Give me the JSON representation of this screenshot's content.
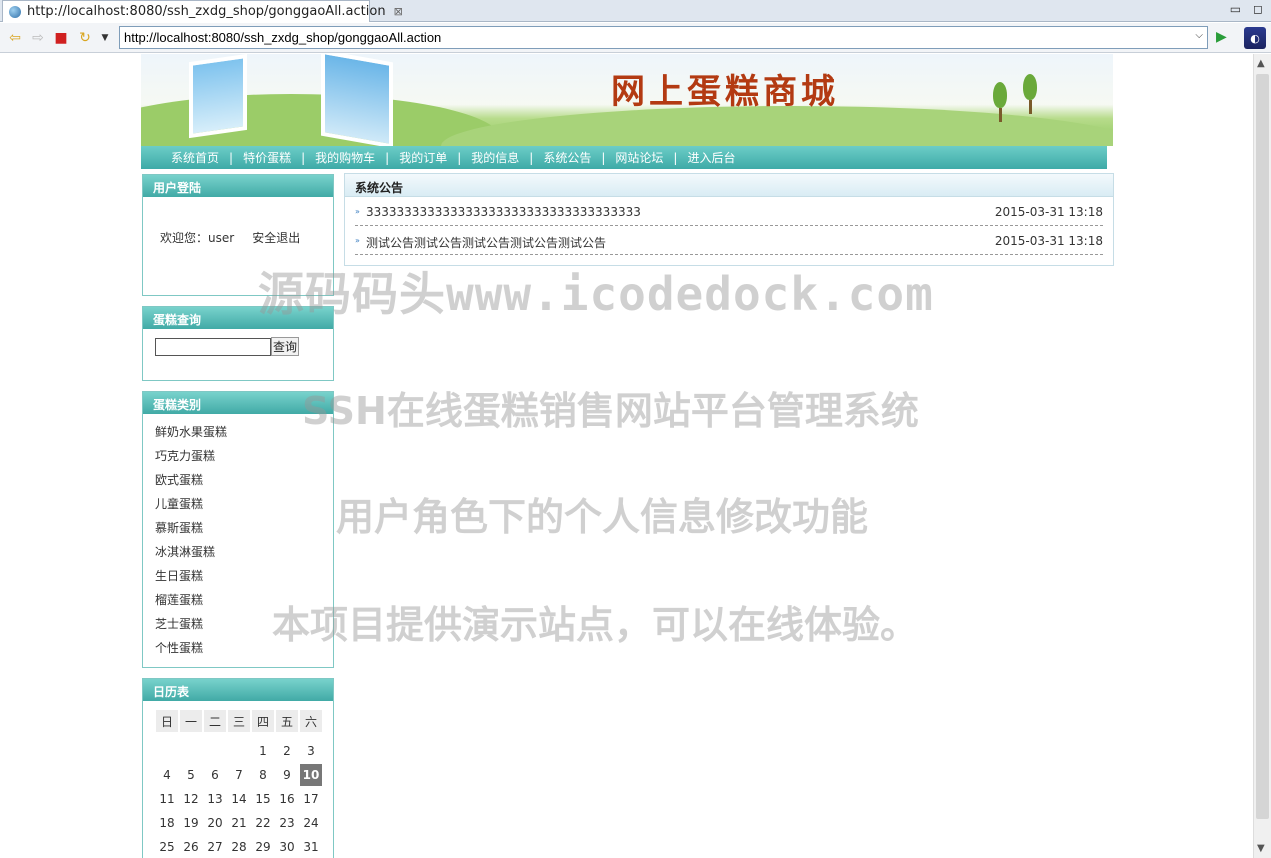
{
  "browser": {
    "tab_title": "http://localhost:8080/ssh_zxdg_shop/gonggaoAll.action",
    "url": "http://localhost:8080/ssh_zxdg_shop/gonggaoAll.action"
  },
  "site": {
    "title": "网上蛋糕商城"
  },
  "nav": [
    "系统首页",
    "特价蛋糕",
    "我的购物车",
    "我的订单",
    "我的信息",
    "系统公告",
    "网站论坛",
    "进入后台"
  ],
  "login": {
    "header": "用户登陆",
    "welcome": "欢迎您：user",
    "logout": "安全退出"
  },
  "search": {
    "header": "蛋糕查询",
    "button": "查询",
    "value": ""
  },
  "categories": {
    "header": "蛋糕类别",
    "items": [
      "鲜奶水果蛋糕",
      "巧克力蛋糕",
      "欧式蛋糕",
      "儿童蛋糕",
      "慕斯蛋糕",
      "冰淇淋蛋糕",
      "生日蛋糕",
      "榴莲蛋糕",
      "芝士蛋糕",
      "个性蛋糕"
    ]
  },
  "calendar": {
    "header": "日历表",
    "weekdays": [
      "日",
      "一",
      "二",
      "三",
      "四",
      "五",
      "六"
    ],
    "weeks": [
      [
        "",
        "",
        "",
        "",
        "1",
        "2",
        "3"
      ],
      [
        "4",
        "5",
        "6",
        "7",
        "8",
        "9",
        "10"
      ],
      [
        "11",
        "12",
        "13",
        "14",
        "15",
        "16",
        "17"
      ],
      [
        "18",
        "19",
        "20",
        "21",
        "22",
        "23",
        "24"
      ],
      [
        "25",
        "26",
        "27",
        "28",
        "29",
        "30",
        "31"
      ]
    ],
    "today": "10"
  },
  "notice": {
    "header": "系统公告",
    "items": [
      {
        "title": "333333333333333333333333333333333333",
        "date": "2015-03-31 13:18"
      },
      {
        "title": "测试公告测试公告测试公告测试公告测试公告",
        "date": "2015-03-31 13:18"
      }
    ]
  },
  "watermarks": [
    "源码码头www.icodedock.com",
    "SSH在线蛋糕销售网站平台管理系统",
    "用户角色下的个人信息修改功能",
    "本项目提供演示站点，可以在线体验。"
  ]
}
